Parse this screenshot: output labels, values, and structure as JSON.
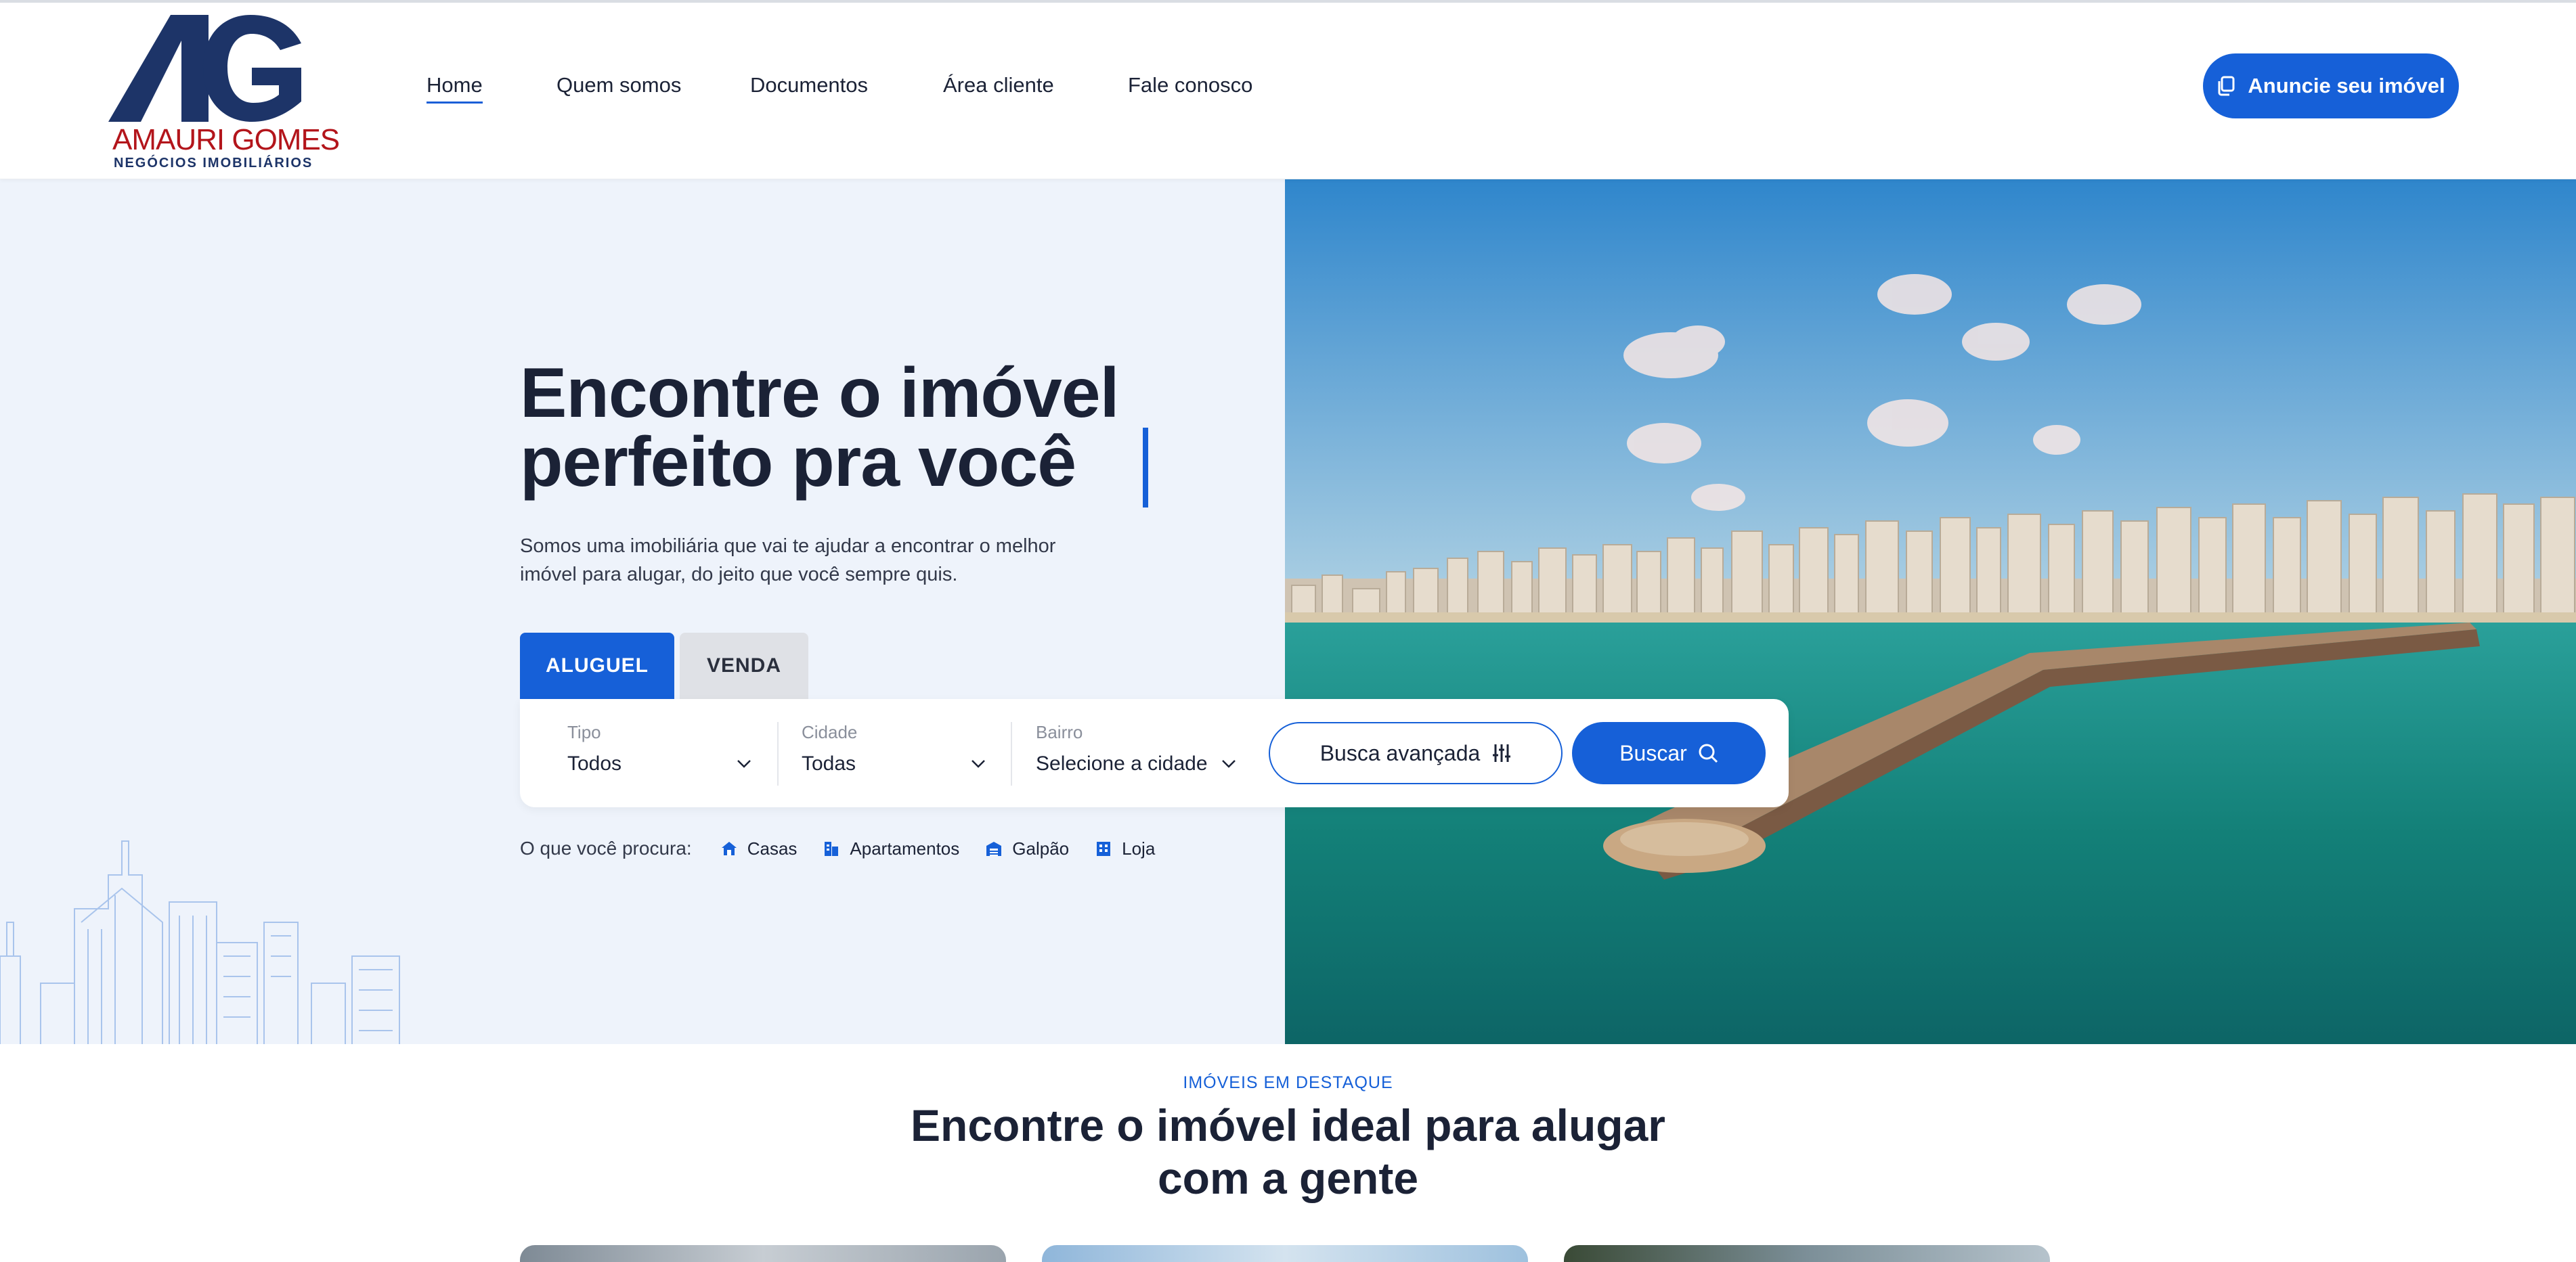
{
  "brand": {
    "monogram": "AG",
    "name": "AMAURI GOMES",
    "tagline": "NEGÓCIOS IMOBILIÁRIOS",
    "colors": {
      "navy": "#1d3468",
      "red": "#b3151b"
    }
  },
  "nav": {
    "items": [
      {
        "label": "Home",
        "active": true
      },
      {
        "label": "Quem somos"
      },
      {
        "label": "Documentos"
      },
      {
        "label": "Área cliente"
      },
      {
        "label": "Fale conosco"
      }
    ],
    "cta_label": "Anuncie seu imóvel",
    "cta_icon": "copy-icon"
  },
  "hero": {
    "title_line1": "Encontre o imóvel",
    "title_line2": "perfeito pra você",
    "subtitle_line1": "Somos uma imobiliária que vai te ajudar a encontrar o melhor",
    "subtitle_line2": "imóvel para alugar, do jeito que você sempre quis.",
    "tabs": [
      {
        "label": "ALUGUEL",
        "selected": true
      },
      {
        "label": "VENDA"
      }
    ]
  },
  "search": {
    "fields": [
      {
        "label": "Tipo",
        "value": "Todos"
      },
      {
        "label": "Cidade",
        "value": "Todas"
      },
      {
        "label": "Bairro",
        "value": "Selecione a cidade"
      }
    ],
    "advanced_label": "Busca avançada",
    "search_label": "Buscar"
  },
  "quick": {
    "label": "O que você procura:",
    "items": [
      {
        "label": "Casas",
        "icon": "house-icon"
      },
      {
        "label": "Apartamentos",
        "icon": "apartment-icon"
      },
      {
        "label": "Galpão",
        "icon": "warehouse-icon"
      },
      {
        "label": "Loja",
        "icon": "store-icon"
      }
    ]
  },
  "featured": {
    "eyebrow": "IMÓVEIS EM DESTAQUE",
    "title_line1": "Encontre o imóvel ideal para alugar",
    "title_line2": "com a gente"
  },
  "colors": {
    "accent": "#1660d8",
    "hero_bg": "#eef3fb",
    "text": "#1b2236"
  }
}
